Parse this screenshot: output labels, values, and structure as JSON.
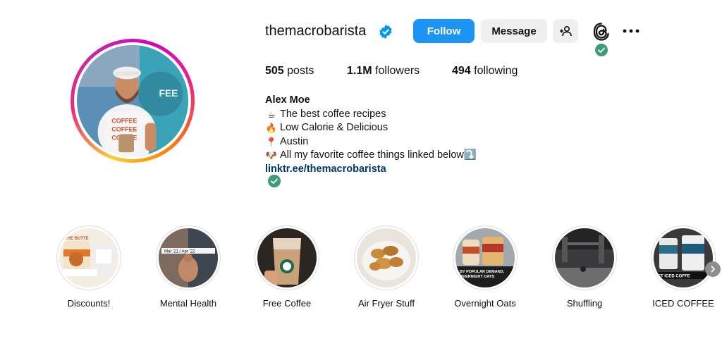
{
  "profile": {
    "username": "themacrobarista",
    "follow_label": "Follow",
    "message_label": "Message",
    "posts_count": "505",
    "posts_label": "posts",
    "followers_count": "1.1M",
    "followers_label": "followers",
    "following_count": "494",
    "following_label": "following"
  },
  "bio": {
    "name": "Alex Moe",
    "lines": [
      {
        "emoji": "☕",
        "text": "The best coffee recipes"
      },
      {
        "emoji": "🔥",
        "text": "Low Calorie & Delicious"
      },
      {
        "emoji": "📍",
        "text": "Austin"
      },
      {
        "emoji": "🐶",
        "text": "All my favorite coffee things linked below⤵️"
      }
    ],
    "link": "linktr.ee/themacrobarista"
  },
  "highlights": [
    {
      "label": "Discounts!",
      "overlay": "THE BUTTE POWDER"
    },
    {
      "label": "Mental Health",
      "overlay": "Mar '21 / Apr '22"
    },
    {
      "label": "Free Coffee",
      "overlay": ""
    },
    {
      "label": "Air Fryer Stuff",
      "overlay": ""
    },
    {
      "label": "Overnight Oats",
      "overlay": "BY POPULAR DEMAND, OVERNIGHT OATS RECIPE"
    },
    {
      "label": "Shuffling",
      "overlay": ""
    },
    {
      "label": "ICED COFFEE",
      "overlay": "ST ICED COFFE"
    }
  ],
  "colors": {
    "follow_button": "#1a95f5",
    "verified": "#0095f6",
    "link": "#00376b",
    "green_check": "#3b9c77"
  }
}
